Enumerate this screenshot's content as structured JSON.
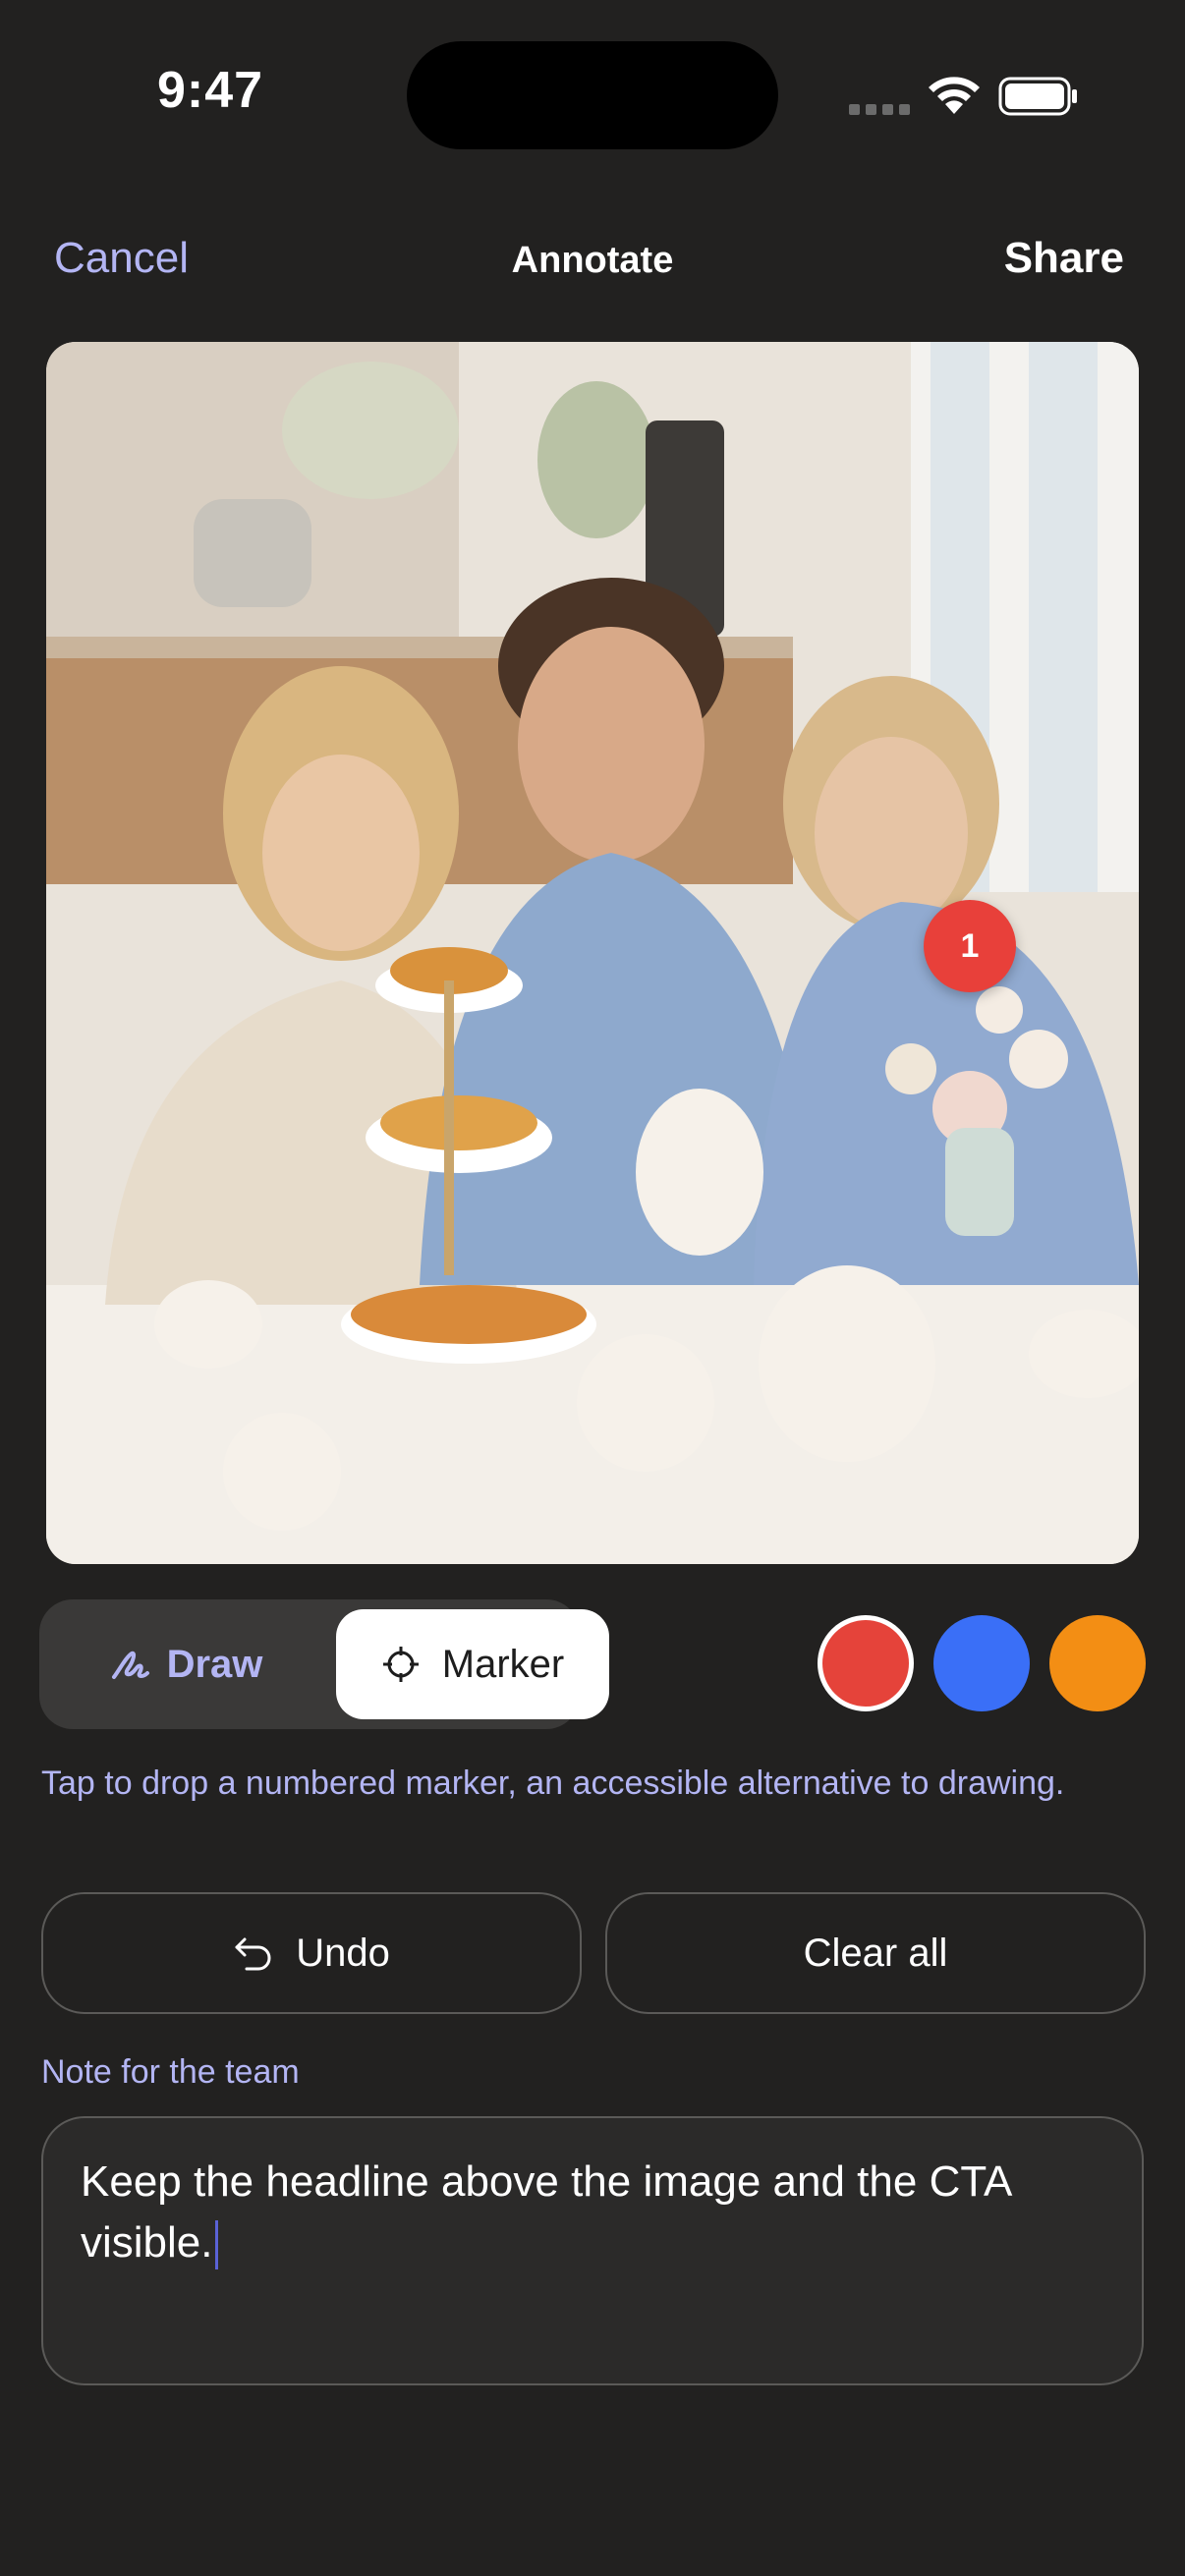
{
  "status_bar": {
    "time": "9:47"
  },
  "nav": {
    "cancel_label": "Cancel",
    "title": "Annotate",
    "share_label": "Share"
  },
  "photo": {
    "marker_number": "1"
  },
  "mode": {
    "draw_label": "Draw",
    "marker_label": "Marker",
    "selected": "Marker"
  },
  "colors": {
    "red": "#e5433a",
    "blue": "#3a6ff7",
    "orange": "#f38e14",
    "selected": "red"
  },
  "hint": "Tap to drop a numbered marker, an accessible alternative to drawing.",
  "actions": {
    "undo_label": "Undo",
    "clear_label": "Clear all"
  },
  "note": {
    "label": "Note for the team",
    "value": "Keep the headline above the image and the CTA visible."
  },
  "accent_color": "#b3b5f3"
}
